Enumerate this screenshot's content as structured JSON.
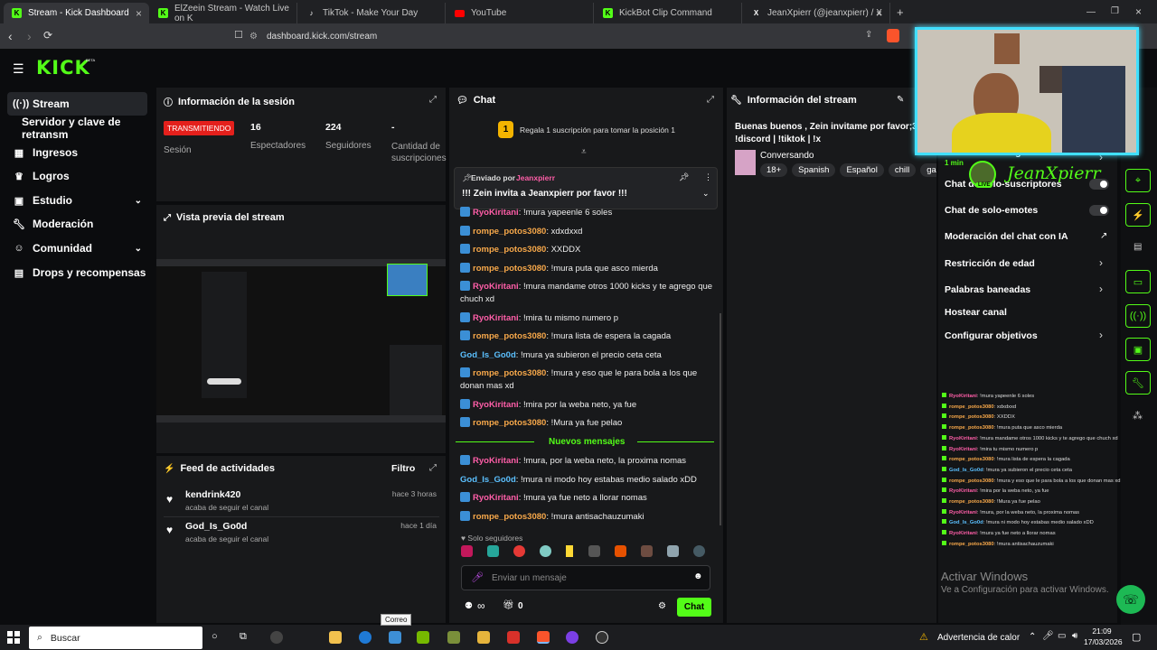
{
  "browser": {
    "tabs": [
      {
        "label": "Stream - Kick Dashboard",
        "icon": "kick-icon",
        "active": true
      },
      {
        "label": "ElZeein Stream - Watch Live on K",
        "icon": "kick-icon"
      },
      {
        "label": "TikTok - Make Your Day",
        "icon": "tiktok-icon"
      },
      {
        "label": "YouTube",
        "icon": "youtube-icon"
      },
      {
        "label": "KickBot Clip Command",
        "icon": "kick-icon"
      },
      {
        "label": "JeanXpierr (@jeanxpierr) / X",
        "icon": "x-icon"
      }
    ],
    "url": "dashboard.kick.com/stream"
  },
  "brand": {
    "logo": "KICK",
    "beta": "BETA",
    "accent": "#53fc18"
  },
  "sidebar": {
    "items": [
      {
        "label": "Stream",
        "icon": "broadcast-icon",
        "active": true
      },
      {
        "label": "Servidor y clave de retransm",
        "icon": ""
      },
      {
        "label": "Ingresos",
        "icon": "chart-icon"
      },
      {
        "label": "Logros",
        "icon": "trophy-icon"
      },
      {
        "label": "Estudio",
        "icon": "studio-icon",
        "chevron": true
      },
      {
        "label": "Moderación",
        "icon": "wrench-icon"
      },
      {
        "label": "Comunidad",
        "icon": "people-icon",
        "chevron": true
      },
      {
        "label": "Drops y recompensas",
        "icon": "gift-icon"
      }
    ]
  },
  "session": {
    "title": "Información de la sesión",
    "status": "TRANSMITIENDO",
    "status_sub": "Sesión",
    "stats": [
      {
        "value": "16",
        "label": "Espectadores"
      },
      {
        "value": "224",
        "label": "Seguidores"
      },
      {
        "value": "-",
        "label": "Cantidad de suscripciones"
      }
    ]
  },
  "preview": {
    "title": "Vista previa del stream"
  },
  "feed": {
    "title": "Feed de actividades",
    "filter": "Filtro",
    "items": [
      {
        "name": "kendrink420",
        "action": "acaba de seguir el canal",
        "time": "hace 3 horas"
      },
      {
        "name": "God_Is_Go0d",
        "action": "acaba de seguir el canal",
        "time": "hace 1 día"
      }
    ]
  },
  "chat": {
    "title": "Chat",
    "sub_rank": "1",
    "sub_prompt": "Regala 1 suscripción para tomar la posición 1",
    "pinned": {
      "sent_by": "Enviado por",
      "user": "Jeanxpierr",
      "text": "!!! Zein invita a Jeanxpierr por favor !!!"
    },
    "messages": [
      {
        "user": "RyoKiritani",
        "text": "!mura yapeenle 6 soles",
        "c": "u1"
      },
      {
        "user": "rompe_potos3080",
        "text": "xdxdxxd",
        "c": "u2"
      },
      {
        "user": "rompe_potos3080",
        "text": "XXDDX",
        "c": "u2"
      },
      {
        "user": "rompe_potos3080",
        "text": "!mura puta que asco mierda",
        "c": "u2"
      },
      {
        "user": "RyoKiritani",
        "text": "!mura mandame otros 1000 kicks y te agrego que chuch xd",
        "c": "u1"
      },
      {
        "user": "RyoKiritani",
        "text": "!mira tu mismo numero p",
        "c": "u1"
      },
      {
        "user": "rompe_potos3080",
        "text": "!mura lista de espera la cagada",
        "c": "u2"
      },
      {
        "user": "God_Is_Go0d",
        "text": "!mura ya subieron el precio ceta ceta",
        "c": "u3"
      },
      {
        "user": "rompe_potos3080",
        "text": "!mura y eso que le para bola a los que donan mas xd",
        "c": "u2"
      },
      {
        "user": "RyoKiritani",
        "text": "!mira por la weba neto, ya fue",
        "c": "u1"
      },
      {
        "user": "rompe_potos3080",
        "text": "!Mura ya fue pelao",
        "c": "u2"
      }
    ],
    "new_label": "Nuevos mensajes",
    "new_messages": [
      {
        "user": "RyoKiritani",
        "text": "!mura, por la weba neto, la proxima nomas",
        "c": "u1"
      },
      {
        "user": "God_Is_Go0d",
        "text": "!mura ni modo hoy estabas medio salado xDD",
        "c": "u3"
      },
      {
        "user": "RyoKiritani",
        "text": "!mura ya fue neto a llorar nomas",
        "c": "u1"
      },
      {
        "user": "rompe_potos3080",
        "text": "!mura antisachauzumaki",
        "c": "u2"
      }
    ],
    "followers_only": "Solo seguidores",
    "input_placeholder": "Enviar un mensaje",
    "points": "∞",
    "gifts": "0",
    "send": "Chat"
  },
  "info": {
    "title": "Información del stream",
    "stream_title": "Buenas buenos , Zein invitame por favor;3 | !|| !discord | !tiktok | !x",
    "category": "Conversando",
    "tags": [
      "18+",
      "Spanish",
      "Español",
      "chill",
      "ga"
    ]
  },
  "settings": {
    "items": [
      {
        "label": "Chat de solo-seguidores",
        "sub": "1 min",
        "type": "chevron"
      },
      {
        "label": "Chat de solo-suscriptores",
        "type": "toggle"
      },
      {
        "label": "Chat de solo-emotes",
        "type": "toggle"
      },
      {
        "label": "Moderación del chat con IA",
        "type": "external"
      },
      {
        "label": "Restricción de edad",
        "type": "chevron"
      },
      {
        "label": "Palabras baneadas",
        "type": "chevron"
      },
      {
        "label": "Hostear canal",
        "type": "none"
      },
      {
        "label": "Configurar objetivos",
        "type": "chevron"
      }
    ]
  },
  "webcam": {
    "name": "JeanXpierr",
    "live": "LIVE"
  },
  "overlay_chat": [
    {
      "user": "RyoKiritani",
      "text": "!mura yapeenle 6 soles",
      "c": "u1"
    },
    {
      "user": "rompe_potos3080",
      "text": "xdxdxxd",
      "c": "u2"
    },
    {
      "user": "rompe_potos3080",
      "text": "XXDDX",
      "c": "u2"
    },
    {
      "user": "rompe_potos3080",
      "text": "!mura puta que asco mierda",
      "c": "u2"
    },
    {
      "user": "RyoKiritani",
      "text": "!mura mandame otros 1000 kicks y te agrego que chuch xd",
      "c": "u1"
    },
    {
      "user": "RyoKiritani",
      "text": "!mira tu mismo numero p",
      "c": "u1"
    },
    {
      "user": "rompe_potos3080",
      "text": "!mura lista de espera la cagada",
      "c": "u2"
    },
    {
      "user": "God_Is_Go0d",
      "text": "!mura ya subieron el precio ceta ceta",
      "c": "u3"
    },
    {
      "user": "rompe_potos3080",
      "text": "!mura y eso que le para bola a los que donan mas xd",
      "c": "u2"
    },
    {
      "user": "RyoKiritani",
      "text": "!mira por la weba neto, ya fue",
      "c": "u1"
    },
    {
      "user": "rompe_potos3080",
      "text": "!Mura ya fue pelao",
      "c": "u2"
    },
    {
      "user": "RyoKiritani",
      "text": "!mura, por la weba neto, la proxima nomas",
      "c": "u1"
    },
    {
      "user": "God_Is_Go0d",
      "text": "!mura ni modo hoy estabas medio salado xDD",
      "c": "u3"
    },
    {
      "user": "RyoKiritani",
      "text": "!mura ya fue neto a llorar nomas",
      "c": "u1"
    },
    {
      "user": "rompe_potos3080",
      "text": "!mura antisachauzumaki",
      "c": "u2"
    }
  ],
  "windows": {
    "activate_title": "Activar Windows",
    "activate_sub": "Ve a Configuración para activar Windows.",
    "search": "Buscar",
    "tooltip": "Correo",
    "heat": "Advertencia de calor",
    "time": "21:09",
    "date": "17/03/2026"
  }
}
